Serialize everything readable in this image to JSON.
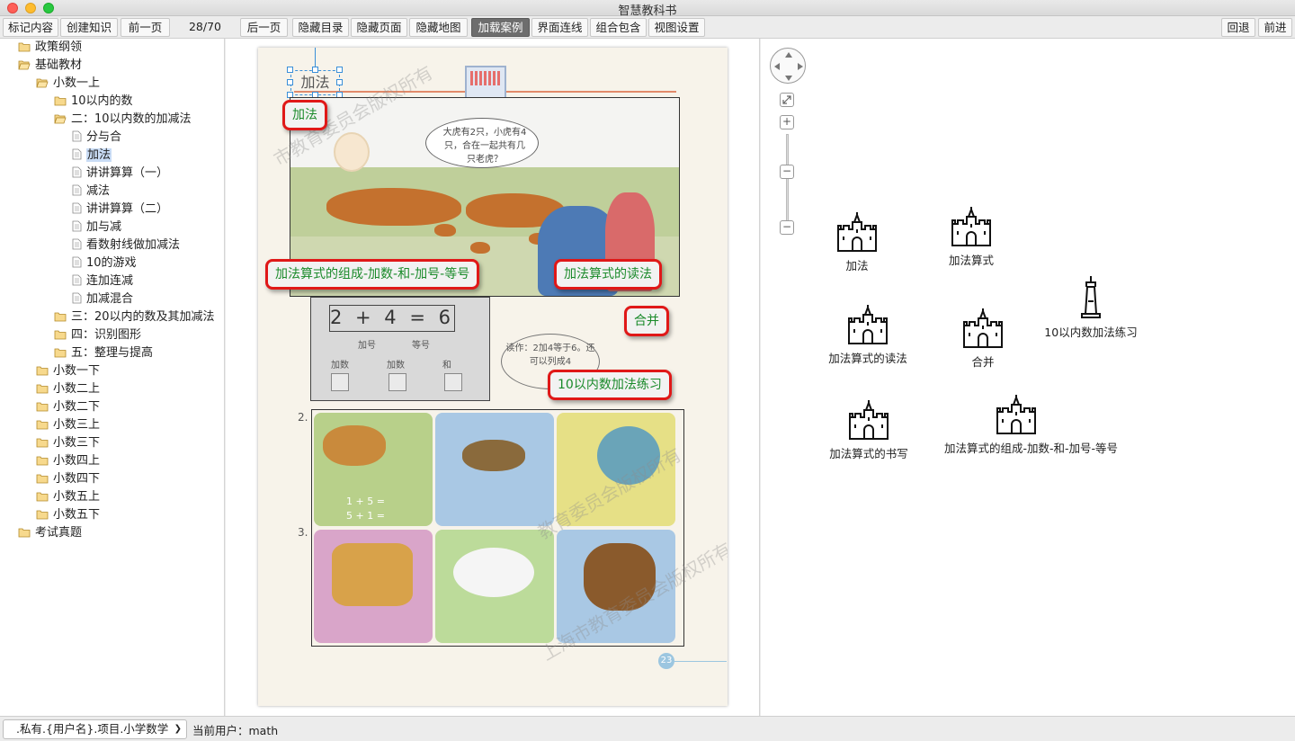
{
  "window": {
    "title": "智慧教科书"
  },
  "toolbar": {
    "mark_content": "标记内容",
    "create_knowledge": "创建知识",
    "prev_page": "前一页",
    "page_indicator": "28/70",
    "next_page": "后一页",
    "hide_toc": "隐藏目录",
    "hide_page": "隐藏页面",
    "hide_map": "隐藏地图",
    "load_cases": "加载案例",
    "ui_links": "界面连线",
    "combine_contain": "组合包含",
    "view_settings": "视图设置",
    "back": "回退",
    "forward": "前进"
  },
  "sidebar": {
    "items": [
      {
        "label": "政策纲领",
        "type": "folder"
      },
      {
        "label": "基础教材",
        "type": "folder-open"
      },
      {
        "label": "小数一上",
        "type": "folder-open"
      },
      {
        "label": "10以内的数",
        "type": "folder"
      },
      {
        "label": "二：10以内数的加减法",
        "type": "folder-open"
      },
      {
        "label": "分与合",
        "type": "doc"
      },
      {
        "label": "加法",
        "type": "doc",
        "selected": true
      },
      {
        "label": "讲讲算算（一）",
        "type": "doc"
      },
      {
        "label": "减法",
        "type": "doc"
      },
      {
        "label": "讲讲算算（二）",
        "type": "doc"
      },
      {
        "label": "加与减",
        "type": "doc"
      },
      {
        "label": "看数射线做加减法",
        "type": "doc"
      },
      {
        "label": "10的游戏",
        "type": "doc"
      },
      {
        "label": "连加连减",
        "type": "doc"
      },
      {
        "label": "加减混合",
        "type": "doc"
      },
      {
        "label": "三：20以内的数及其加减法",
        "type": "folder"
      },
      {
        "label": "四：识别图形",
        "type": "folder"
      },
      {
        "label": "五：整理与提高",
        "type": "folder"
      },
      {
        "label": "小数一下",
        "type": "folder"
      },
      {
        "label": "小数二上",
        "type": "folder"
      },
      {
        "label": "小数二下",
        "type": "folder"
      },
      {
        "label": "小数三上",
        "type": "folder"
      },
      {
        "label": "小数三下",
        "type": "folder"
      },
      {
        "label": "小数四上",
        "type": "folder"
      },
      {
        "label": "小数四下",
        "type": "folder"
      },
      {
        "label": "小数五上",
        "type": "folder"
      },
      {
        "label": "小数五下",
        "type": "folder"
      },
      {
        "label": "考试真题",
        "type": "folder"
      }
    ]
  },
  "document": {
    "page_title": "加法",
    "speech": "大虎有2只，小虎有4只，合在一起共有几只老虎？",
    "equation": "2 + 4 = 6",
    "eq_labels": {
      "addend_mid": "加号",
      "equals_label": "等号",
      "addend1": "加数",
      "addend2": "加数",
      "sum": "和"
    },
    "reading": "读作：2加4等于6。还可以列成4",
    "q2": "2.",
    "q3": "3.",
    "eq_a": "1 + 5 =",
    "eq_b": "5 + 1 =",
    "page_number": "23",
    "watermarks": [
      "市教育委员会版权所有",
      "教育委员会版权所有",
      "上海市教育委员会版权所有"
    ],
    "tags": {
      "addition": "加法",
      "composition": "加法算式的组成-加数-和-加号-等号",
      "reading": "加法算式的读法",
      "merge": "合并",
      "practice": "10以内数加法练习"
    }
  },
  "graph": {
    "nodes": [
      {
        "label": "加法",
        "icon": "castle-icon"
      },
      {
        "label": "加法算式",
        "icon": "castle-icon"
      },
      {
        "label": "10以内数加法练习",
        "icon": "tower-icon"
      },
      {
        "label": "加法算式的读法",
        "icon": "castle-icon"
      },
      {
        "label": "合并",
        "icon": "castle-icon"
      },
      {
        "label": "加法算式的书写",
        "icon": "castle-icon"
      },
      {
        "label": "加法算式的组成-加数-和-加号-等号",
        "icon": "castle-icon"
      }
    ],
    "zoom_in": "+",
    "zoom_out": "−",
    "zoom_mid": "−"
  },
  "status": {
    "project": ".私有.{用户名}.项目.小学数学",
    "current_user": "当前用户：math"
  },
  "colors": {
    "tag_border": "#e01818",
    "tag_text": "#1a8a2a",
    "active_button": "#6d6d6d"
  }
}
